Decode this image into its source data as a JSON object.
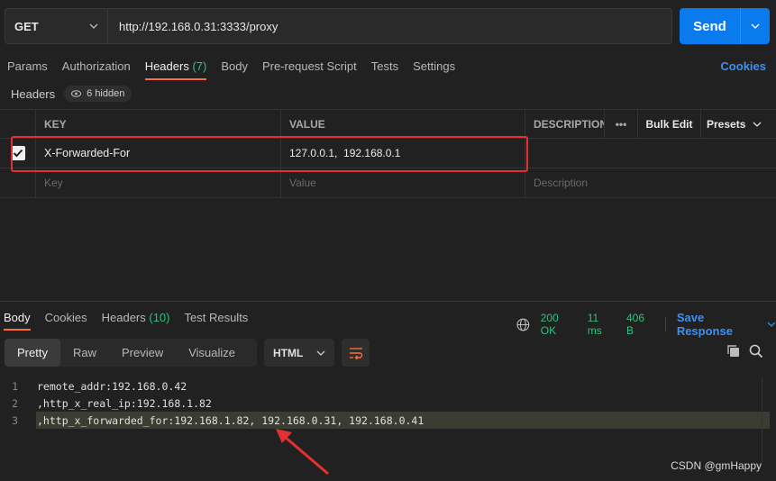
{
  "request": {
    "method": "GET",
    "url": "http://192.168.0.31:3333/proxy",
    "send_label": "Send"
  },
  "tabs": [
    {
      "label": "Params"
    },
    {
      "label": "Authorization"
    },
    {
      "label": "Headers",
      "count": "(7)"
    },
    {
      "label": "Body"
    },
    {
      "label": "Pre-request Script"
    },
    {
      "label": "Tests"
    },
    {
      "label": "Settings"
    }
  ],
  "cookies_label": "Cookies",
  "headers_section": {
    "title": "Headers",
    "hidden_label": "6 hidden"
  },
  "table": {
    "columns": {
      "key": "KEY",
      "value": "VALUE",
      "description": "DESCRIPTION",
      "more": "•••",
      "bulk_edit": "Bulk Edit",
      "presets": "Presets"
    },
    "rows": [
      {
        "key": "X-Forwarded-For",
        "value": "127.0.0.1,  192.168.0.1",
        "description": "",
        "checked": true
      }
    ],
    "placeholder": {
      "key": "Key",
      "value": "Value",
      "description": "Description"
    }
  },
  "response": {
    "tabs": [
      {
        "label": "Body"
      },
      {
        "label": "Cookies"
      },
      {
        "label": "Headers",
        "count": "(10)"
      },
      {
        "label": "Test Results"
      }
    ],
    "status": "200 OK",
    "time": "11 ms",
    "size": "406 B",
    "save_label": "Save Response",
    "view_modes": [
      "Pretty",
      "Raw",
      "Preview",
      "Visualize"
    ],
    "format": "HTML",
    "lines": [
      {
        "num": "1",
        "text": "remote_addr:192.168.0.42"
      },
      {
        "num": "2",
        "text": ",http_x_real_ip:192.168.1.82"
      },
      {
        "num": "3",
        "text": ",http_x_forwarded_for:192.168.1.82, 192.168.0.31, 192.168.0.41"
      }
    ]
  },
  "watermark": "CSDN @gmHappy",
  "colors": {
    "accent": "#ff6c37",
    "primary": "#097bed",
    "success": "#2ec27e",
    "annotation": "#e53030"
  }
}
